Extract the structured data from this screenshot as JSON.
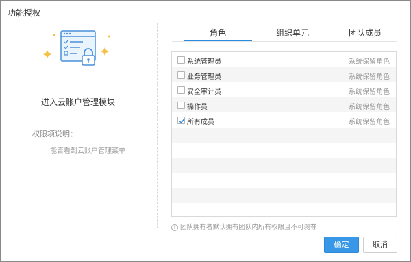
{
  "dialog": {
    "title": "功能授权"
  },
  "left": {
    "module_title": "进入云账户管理模块",
    "perm_label": "权限项说明：",
    "perm_desc": "能否看到云账户管理菜单"
  },
  "tabs": [
    {
      "label": "角色",
      "active": true
    },
    {
      "label": "组织单元",
      "active": false
    },
    {
      "label": "团队成员",
      "active": false
    }
  ],
  "roles": [
    {
      "name": "系统管理员",
      "tag": "系统保留角色",
      "checked": false
    },
    {
      "name": "业务管理员",
      "tag": "系统保留角色",
      "checked": false
    },
    {
      "name": "安全审计员",
      "tag": "系统保留角色",
      "checked": false
    },
    {
      "name": "操作员",
      "tag": "系统保留角色",
      "checked": false
    },
    {
      "name": "所有成员",
      "tag": "系统保留角色",
      "checked": true
    }
  ],
  "note": "团队拥有者默认拥有团队内所有权限且不可剥夺",
  "buttons": {
    "ok": "确定",
    "cancel": "取消"
  },
  "colors": {
    "accent": "#3897e6",
    "tab_underline": "#2a8be0",
    "check": "#2a8be0"
  },
  "icons": {
    "illustration": "window-lock-illustration",
    "info": "info-icon",
    "check": "check-icon"
  }
}
